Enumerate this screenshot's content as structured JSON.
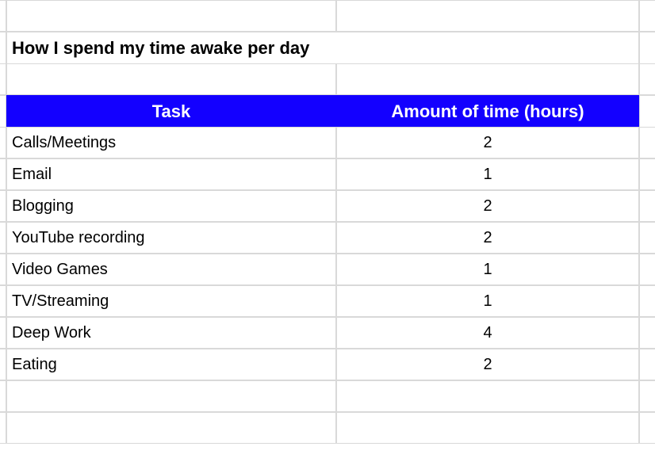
{
  "title": "How I spend my time awake per day",
  "columns": {
    "task": "Task",
    "amount": "Amount of time (hours)"
  },
  "rows": [
    {
      "task": "Calls/Meetings",
      "amount": "2"
    },
    {
      "task": "Email",
      "amount": "1"
    },
    {
      "task": "Blogging",
      "amount": "2"
    },
    {
      "task": "YouTube recording",
      "amount": "2"
    },
    {
      "task": "Video Games",
      "amount": "1"
    },
    {
      "task": "TV/Streaming",
      "amount": "1"
    },
    {
      "task": "Deep Work",
      "amount": "4"
    },
    {
      "task": "Eating",
      "amount": "2"
    }
  ],
  "chart_data": {
    "type": "table",
    "title": "How I spend my time awake per day",
    "columns": [
      "Task",
      "Amount of time (hours)"
    ],
    "data": [
      [
        "Calls/Meetings",
        2
      ],
      [
        "Email",
        1
      ],
      [
        "Blogging",
        2
      ],
      [
        "YouTube recording",
        2
      ],
      [
        "Video Games",
        1
      ],
      [
        "TV/Streaming",
        1
      ],
      [
        "Deep Work",
        4
      ],
      [
        "Eating",
        2
      ]
    ]
  }
}
